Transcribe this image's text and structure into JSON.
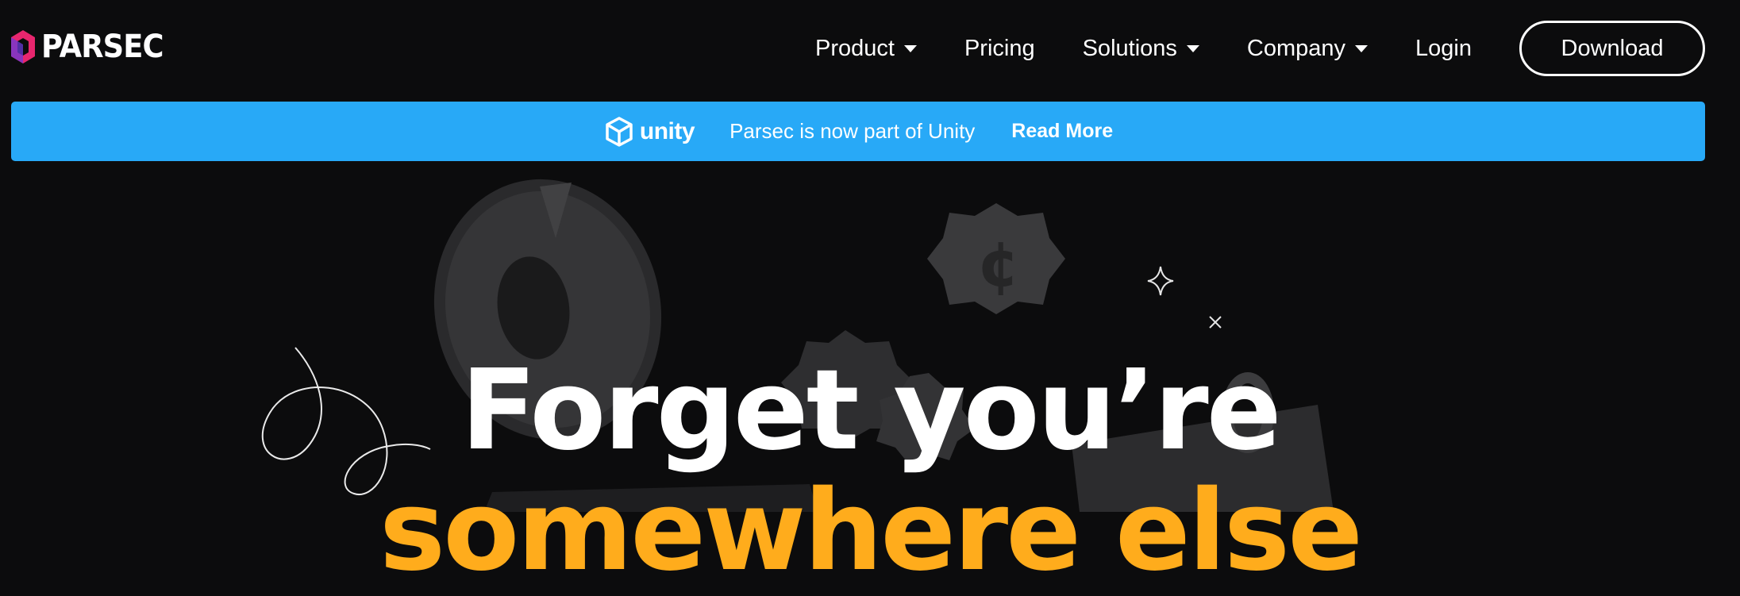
{
  "brand": {
    "name": "PARSEC",
    "logo_icon": "parsec-logo-icon"
  },
  "nav": {
    "items": [
      {
        "label": "Product",
        "dropdown": true
      },
      {
        "label": "Pricing",
        "dropdown": false
      },
      {
        "label": "Solutions",
        "dropdown": true
      },
      {
        "label": "Company",
        "dropdown": true
      },
      {
        "label": "Login",
        "dropdown": false
      }
    ],
    "download_label": "Download"
  },
  "banner": {
    "brand": "unity",
    "text": "Parsec is now part of Unity",
    "link": "Read More",
    "color": "#28a9f7"
  },
  "hero": {
    "line1": "Forget you’re",
    "line2": "somewhere else",
    "line2_color": "#ffac1c",
    "decorations": [
      "donut-chart-3d",
      "cent-badge-3d",
      "gear-badge-3d",
      "sparkle-icon",
      "x-mark-icon",
      "squiggle-line",
      "dark-block-3d"
    ]
  },
  "colors": {
    "background": "#0c0c0d",
    "accent_blue": "#28a9f7",
    "accent_orange": "#ffac1c"
  }
}
